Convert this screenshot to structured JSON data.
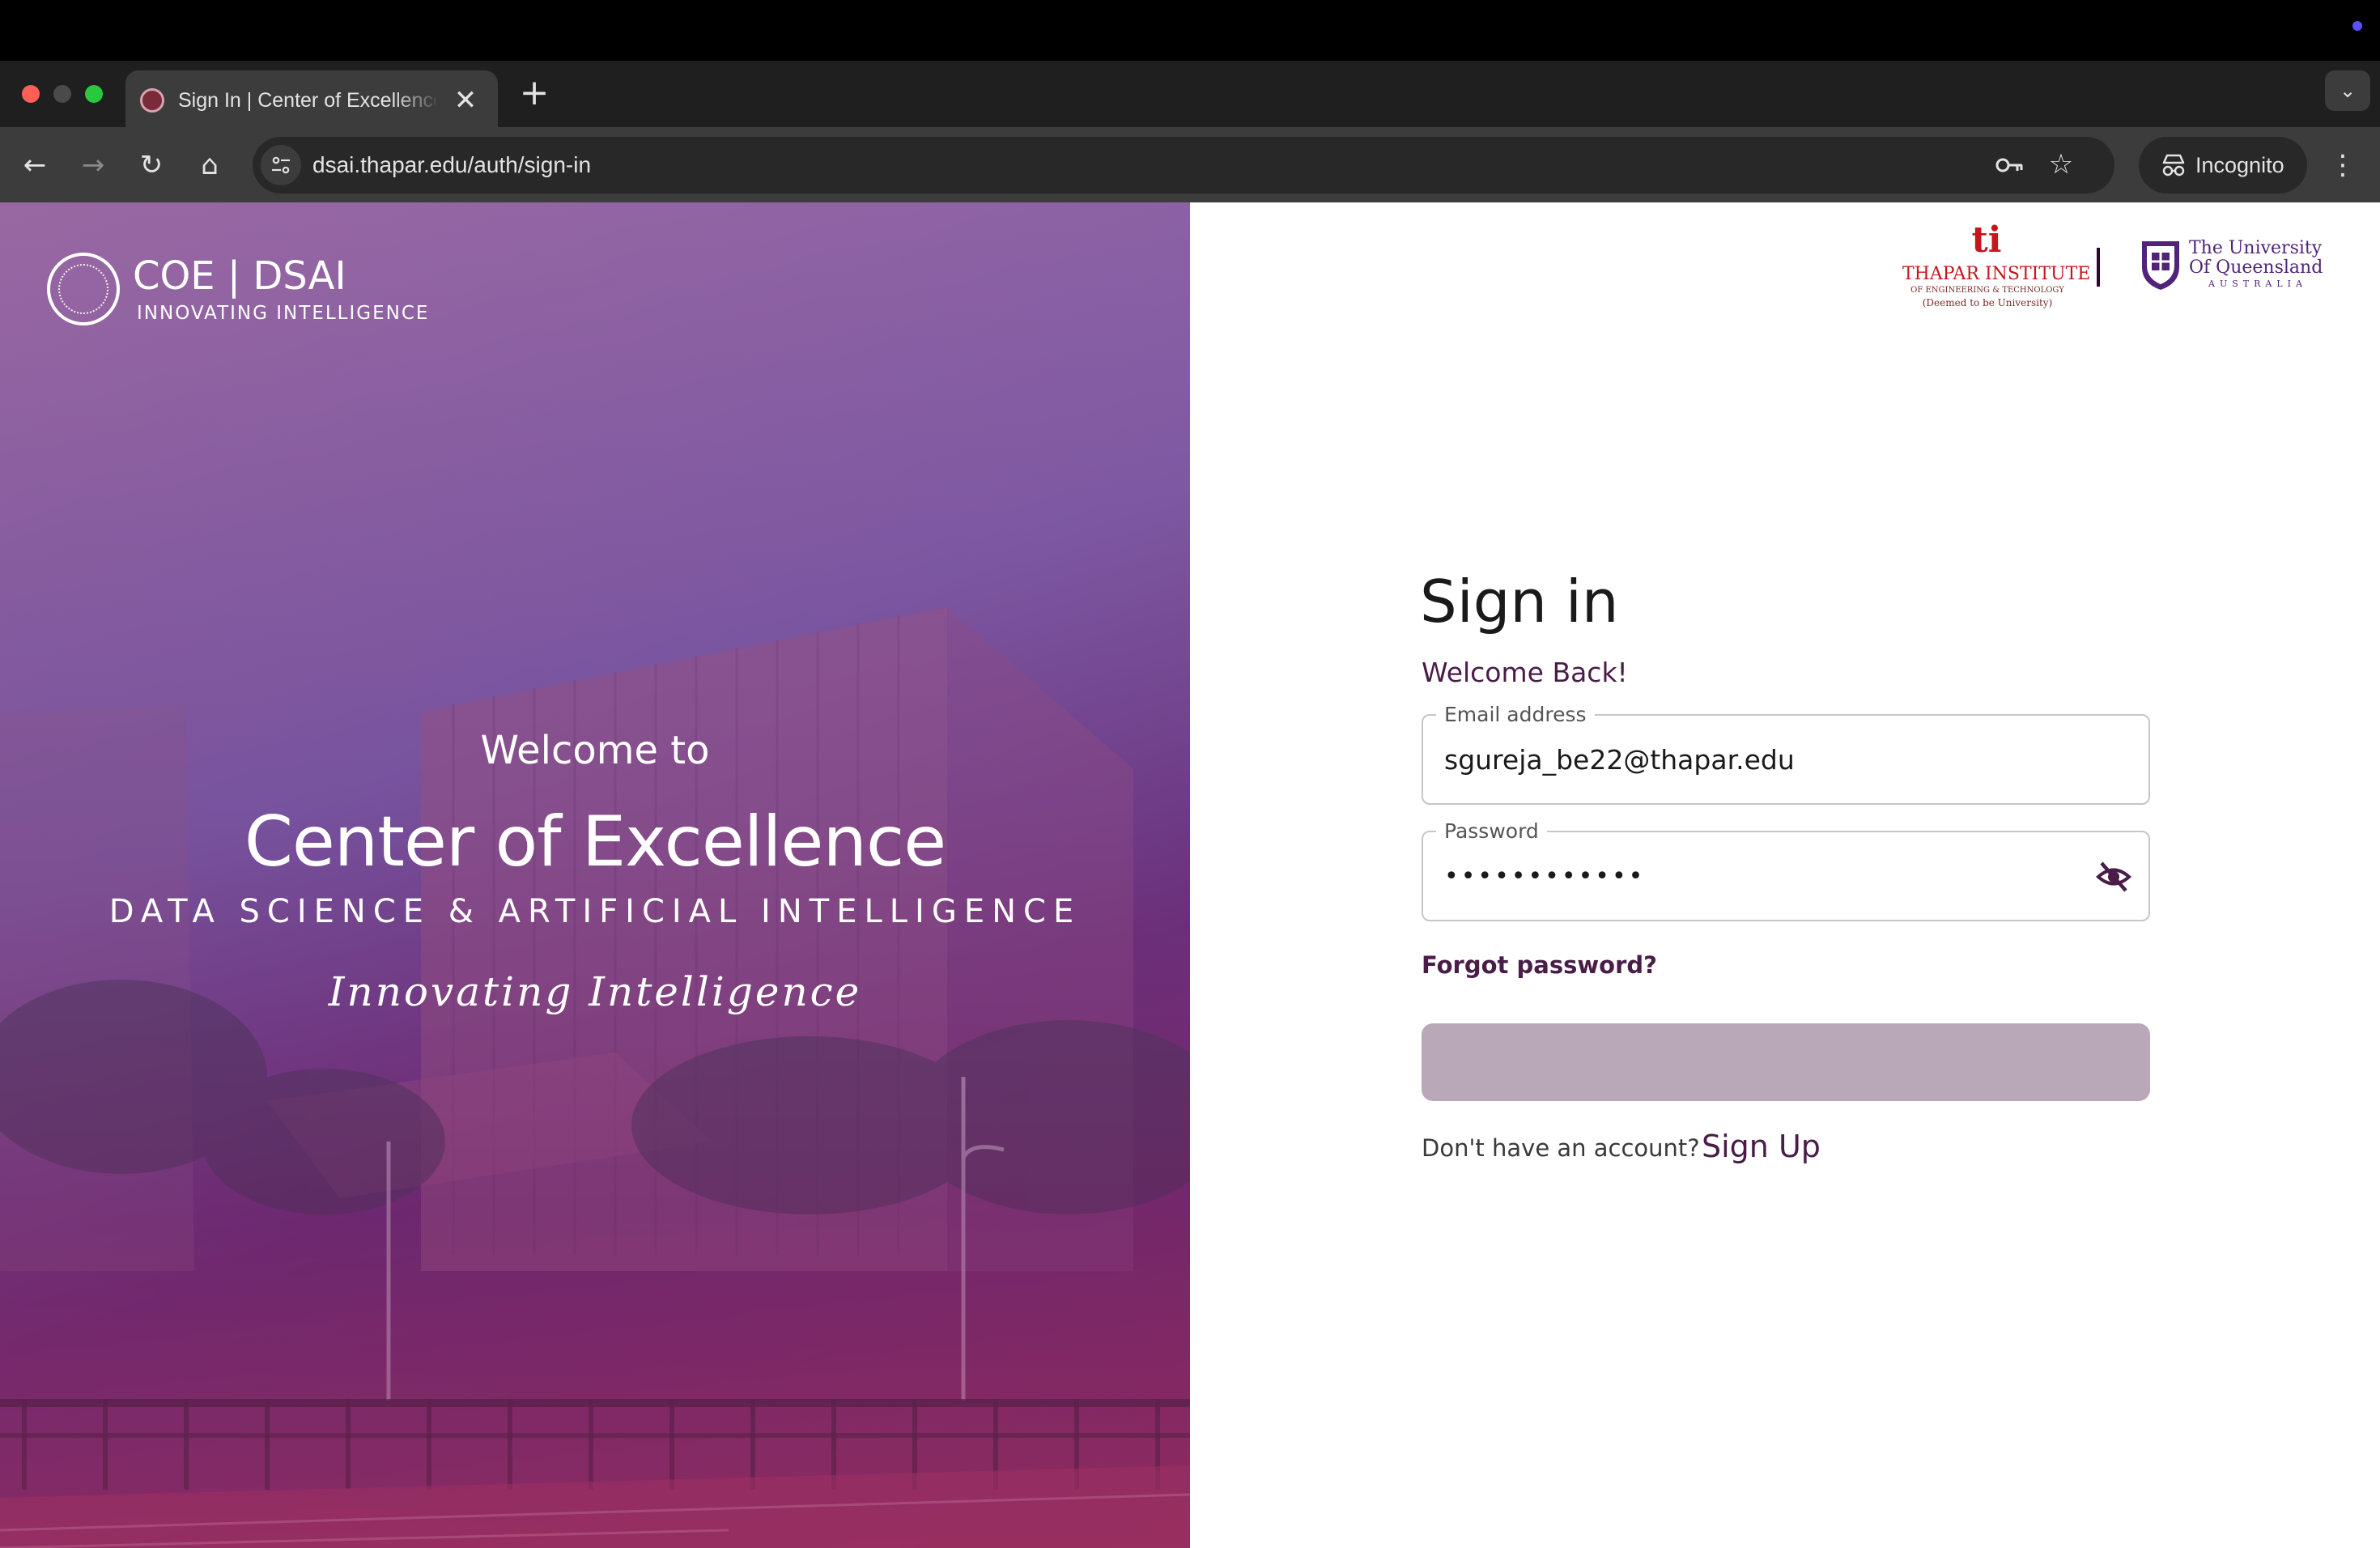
{
  "browser": {
    "tab": {
      "title": "Sign In | Center of Excellence",
      "close_glyph": "✕",
      "favicon": "coe-favicon-icon"
    },
    "new_tab_glyph": "+",
    "tab_search_glyph": "⌄",
    "nav": {
      "back_glyph": "←",
      "forward_glyph": "→",
      "reload_glyph": "↻",
      "home_glyph": "⌂"
    },
    "url": "dsai.thapar.edu/auth/sign-in",
    "incognito_label": "Incognito",
    "menu_glyph": "⋮",
    "star_glyph": "☆"
  },
  "hero": {
    "brand": "COE | DSAI",
    "tagline": "INNOVATING INTELLIGENCE",
    "welcome": "Welcome to",
    "title": "Center of Excellence",
    "subtitle": "DATA SCIENCE & ARTIFICIAL INTELLIGENCE",
    "motto": "Innovating Intelligence"
  },
  "partners": {
    "thapar": {
      "mark": "ti",
      "name": "THAPAR INSTITUTE",
      "sub": "OF ENGINEERING & TECHNOLOGY",
      "sub2": "(Deemed to be University)"
    },
    "uq": {
      "line1": "The University",
      "line2": "Of Queensland",
      "country": "AUSTRALIA"
    }
  },
  "signin": {
    "title": "Sign in",
    "welcome": "Welcome Back!",
    "email_label": "Email address",
    "email_value": "sgureja_be22@thapar.edu",
    "password_label": "Password",
    "password_value": "••••••••••••",
    "forgot": "Forgot password?",
    "no_account": "Don't have an account?",
    "signup": "Sign Up"
  },
  "colors": {
    "accent": "#4a1c48",
    "button_disabled": "#b9a8b8",
    "hero_purple": "#7a5aa4"
  }
}
